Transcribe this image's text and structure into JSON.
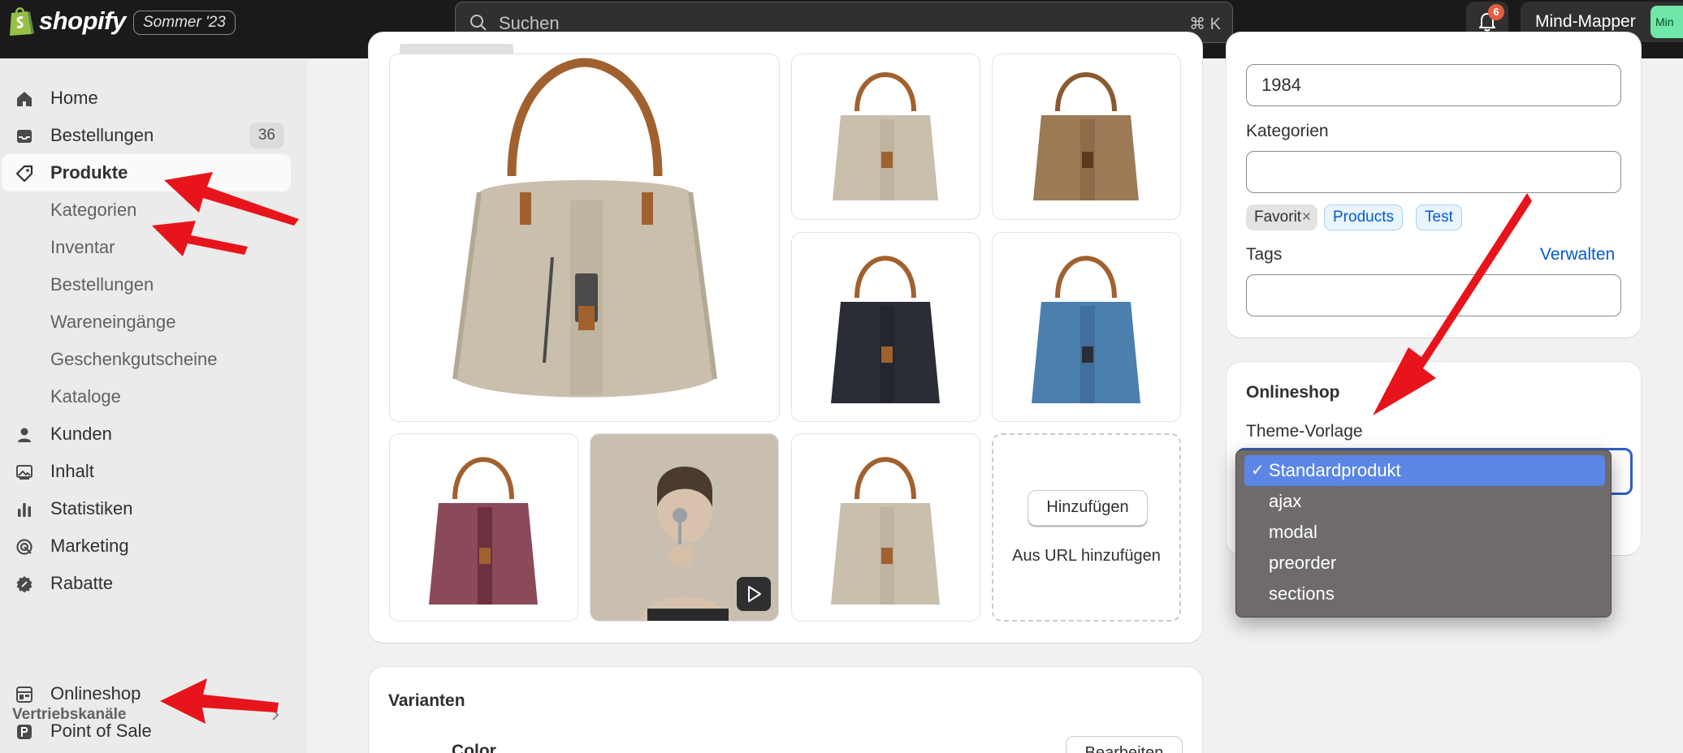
{
  "topbar": {
    "brand": "shopify",
    "season_badge": "Sommer '23",
    "search_placeholder": "Suchen",
    "search_shortcut": "⌘ K",
    "notification_count": "6",
    "user_name": "Mind-Mapper",
    "avatar_text": "Min"
  },
  "sidebar": {
    "items": [
      {
        "label": "Home",
        "icon": "home-icon"
      },
      {
        "label": "Bestellungen",
        "icon": "inbox-icon",
        "count": "36"
      },
      {
        "label": "Produkte",
        "icon": "tag-icon",
        "active": true
      },
      {
        "label": "Kategorien"
      },
      {
        "label": "Inventar"
      },
      {
        "label": "Bestellungen"
      },
      {
        "label": "Wareneingänge"
      },
      {
        "label": "Geschenkgutscheine"
      },
      {
        "label": "Kataloge"
      },
      {
        "label": "Kunden",
        "icon": "person-icon"
      },
      {
        "label": "Inhalt",
        "icon": "image-icon"
      },
      {
        "label": "Statistiken",
        "icon": "bar-chart-icon"
      },
      {
        "label": "Marketing",
        "icon": "target-icon"
      },
      {
        "label": "Rabatte",
        "icon": "discount-icon"
      }
    ],
    "section_label": "Vertriebskanäle",
    "channels": [
      {
        "label": "Onlineshop",
        "icon": "store-icon"
      },
      {
        "label": "Point of Sale",
        "icon": "pos-icon"
      }
    ]
  },
  "media": {
    "add_button": "Hinzufügen",
    "add_from_url": "Aus URL hinzufügen"
  },
  "variants": {
    "title": "Varianten",
    "option_name": "Color",
    "edit_button": "Bearbeiten"
  },
  "organization": {
    "field_value": "1984",
    "categories_label": "Kategorien",
    "categories_value": "",
    "collections": [
      "Favorit",
      "Products",
      "Test"
    ],
    "tags_label": "Tags",
    "tags_manage_link": "Verwalten",
    "tags_value": ""
  },
  "online_store": {
    "title": "Onlineshop",
    "theme_label": "Theme-Vorlage",
    "theme_options": [
      "Standardprodukt",
      "ajax",
      "modal",
      "preorder",
      "sections"
    ],
    "selected_option": "Standardprodukt",
    "check_mark": "✓"
  },
  "colors": {
    "topbar_bg": "#1a1a1a",
    "annotation_arrow": "#e8141b",
    "dropdown_selected": "#5b86e5"
  }
}
